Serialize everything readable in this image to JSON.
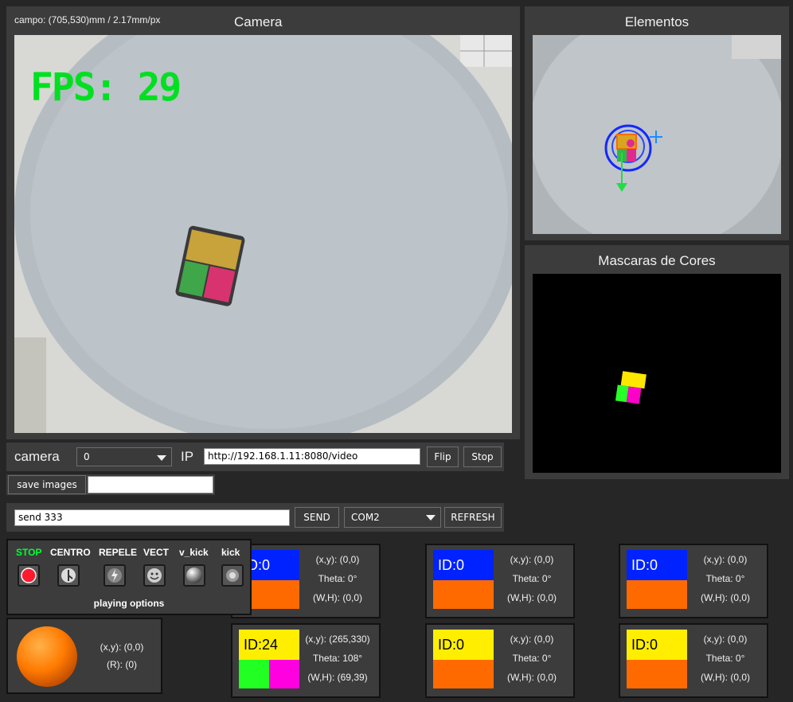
{
  "camera_panel": {
    "title": "Camera",
    "calibration": "campo: (705,530)mm / 2.17mm/px",
    "fps": "FPS: 29"
  },
  "elements_panel": {
    "title": "Elementos"
  },
  "masks_panel": {
    "title": "Mascaras de Cores"
  },
  "camera_controls": {
    "camera_label": "camera",
    "camera_value": "0",
    "ip_label": "IP",
    "ip_value": "http://192.168.1.11:8080/video",
    "flip_label": "Flip",
    "stop_label": "Stop",
    "save_images_label": "save images",
    "save_images_value": ""
  },
  "serial": {
    "command_value": "send 333",
    "send_label": "SEND",
    "port_value": "COM2",
    "refresh_label": "REFRESH"
  },
  "playing_options": {
    "footer": "playing options",
    "options": [
      {
        "label": "STOP",
        "color": "#00ff33",
        "icon": "stop-icon"
      },
      {
        "label": "CENTRO",
        "color": "#ffffff",
        "icon": "center-icon"
      },
      {
        "label": "REPELE",
        "color": "#ffffff",
        "icon": "lightning-icon"
      },
      {
        "label": "VECT",
        "color": "#ffffff",
        "icon": "face-icon"
      },
      {
        "label": "v_kick",
        "color": "#ffffff",
        "icon": "sphere-icon"
      },
      {
        "label": "kick",
        "color": "#ffffff",
        "icon": "dot-icon"
      }
    ]
  },
  "ball": {
    "pos": "(x,y): (0,0)",
    "radius": "(R): (0)"
  },
  "robots": [
    {
      "id": "ID:0",
      "top_color": "#0022ff",
      "id_color": "#ffffff",
      "pos": "(x,y): (0,0)",
      "theta": "Theta: 0°",
      "size": "(W,H): (0,0)"
    },
    {
      "id": "ID:0",
      "top_color": "#0022ff",
      "id_color": "#ffffff",
      "pos": "(x,y): (0,0)",
      "theta": "Theta: 0°",
      "size": "(W,H): (0,0)"
    },
    {
      "id": "ID:0",
      "top_color": "#0022ff",
      "id_color": "#ffffff",
      "pos": "(x,y): (0,0)",
      "theta": "Theta: 0°",
      "size": "(W,H): (0,0)"
    },
    {
      "id": "ID:24",
      "top_color": "#ffee00",
      "id_color": "#000000",
      "pos": "(x,y): (265,330)",
      "theta": "Theta: 108°",
      "size": "(W,H): (69,39)"
    },
    {
      "id": "ID:0",
      "top_color": "#ffee00",
      "id_color": "#000000",
      "pos": "(x,y): (0,0)",
      "theta": "Theta: 0°",
      "size": "(W,H): (0,0)"
    },
    {
      "id": "ID:0",
      "top_color": "#ffee00",
      "id_color": "#000000",
      "pos": "(x,y): (0,0)",
      "theta": "Theta: 0°",
      "size": "(W,H): (0,0)"
    }
  ]
}
